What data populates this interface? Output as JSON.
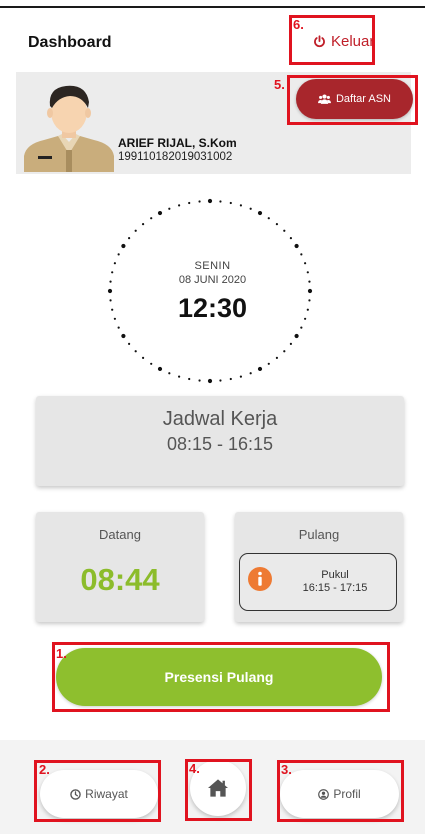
{
  "header": {
    "title": "Dashboard",
    "logout_label": "Keluar",
    "logout_icon": "power-icon"
  },
  "profile": {
    "name": "ARIEF RIJAL, S.Kom",
    "nip": "199110182019031002",
    "avatar_icon": "user-avatar-icon",
    "asn_button_label": "Daftar ASN",
    "asn_button_icon": "users-icon"
  },
  "clock": {
    "day": "SENIN",
    "date": "08 JUNI 2020",
    "time": "12:30"
  },
  "schedule": {
    "title": "Jadwal Kerja",
    "time": "08:15 - 16:15"
  },
  "arrival": {
    "label": "Datang",
    "time": "08:44"
  },
  "departure": {
    "label": "Pulang",
    "info_icon": "info-icon",
    "pukul_label": "Pukul",
    "range": "16:15 - 17:15"
  },
  "action": {
    "label": "Presensi Pulang"
  },
  "nav": {
    "riwayat_label": "Riwayat",
    "riwayat_icon": "clock-icon",
    "home_icon": "home-icon",
    "profil_label": "Profil",
    "profil_icon": "user-circle-icon"
  },
  "annotations": {
    "n1": "1.",
    "n2": "2.",
    "n3": "3.",
    "n4": "4.",
    "n5": "5.",
    "n6": "6."
  },
  "colors": {
    "accent_green": "#8ebf2e",
    "time_green": "#8cbc2b",
    "danger_red": "#a8262c",
    "logout_red": "#c0202a",
    "annotation_red": "#e0131f",
    "info_orange": "#ee7a33"
  }
}
